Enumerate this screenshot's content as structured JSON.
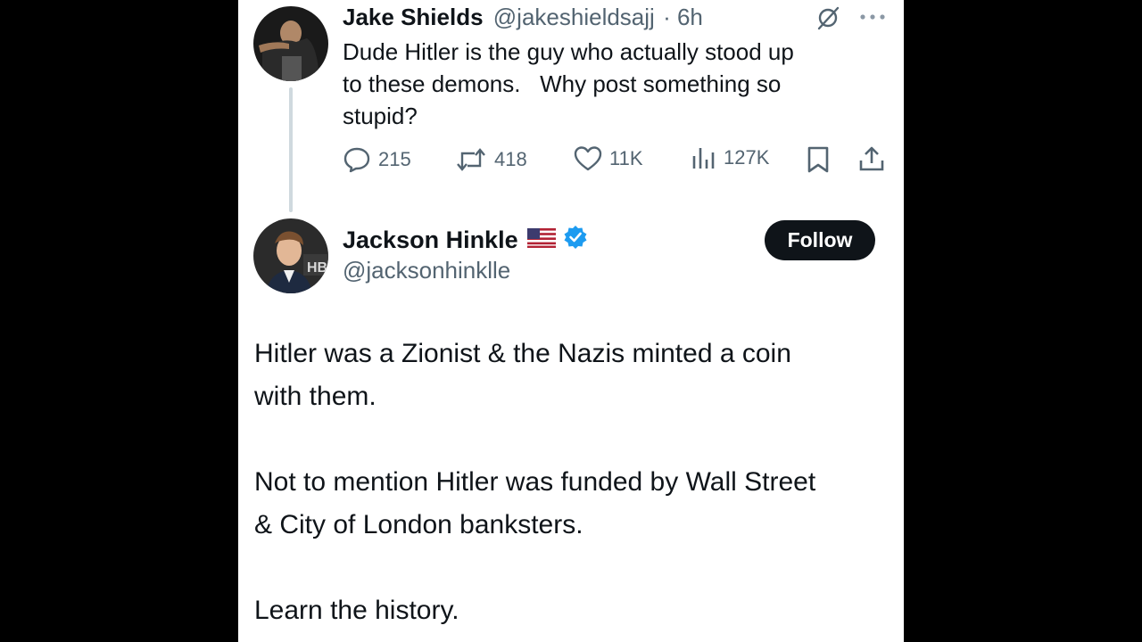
{
  "reply": {
    "name": "Jake Shields",
    "handle": "@jakeshieldsajj",
    "time": "· 6h",
    "text": "Dude Hitler is the guy who actually stood up\nto these demons.   Why post something so\nstupid?",
    "actions": {
      "replies": "215",
      "reposts": "418",
      "likes": "11K",
      "views": "127K"
    },
    "icons": [
      "grok-icon",
      "more-icon",
      "reply-icon",
      "repost-icon",
      "like-icon",
      "views-icon",
      "bookmark-icon",
      "share-icon"
    ]
  },
  "main": {
    "name": "Jackson Hinkle",
    "flag": "🇺🇸",
    "handle": "@jacksonhinklle",
    "follow_label": "Follow",
    "paragraphs": [
      "Hitler was a Zionist & the Nazis minted a coin\nwith them.",
      "Not to mention Hitler was funded by Wall Street\n& City of London banksters.",
      "Learn the history."
    ]
  },
  "colors": {
    "text": "#0f1419",
    "secondary": "#536471",
    "verified": "#1d9bf0",
    "thread_line": "#cfd9de",
    "follow_bg": "#0f1419"
  }
}
